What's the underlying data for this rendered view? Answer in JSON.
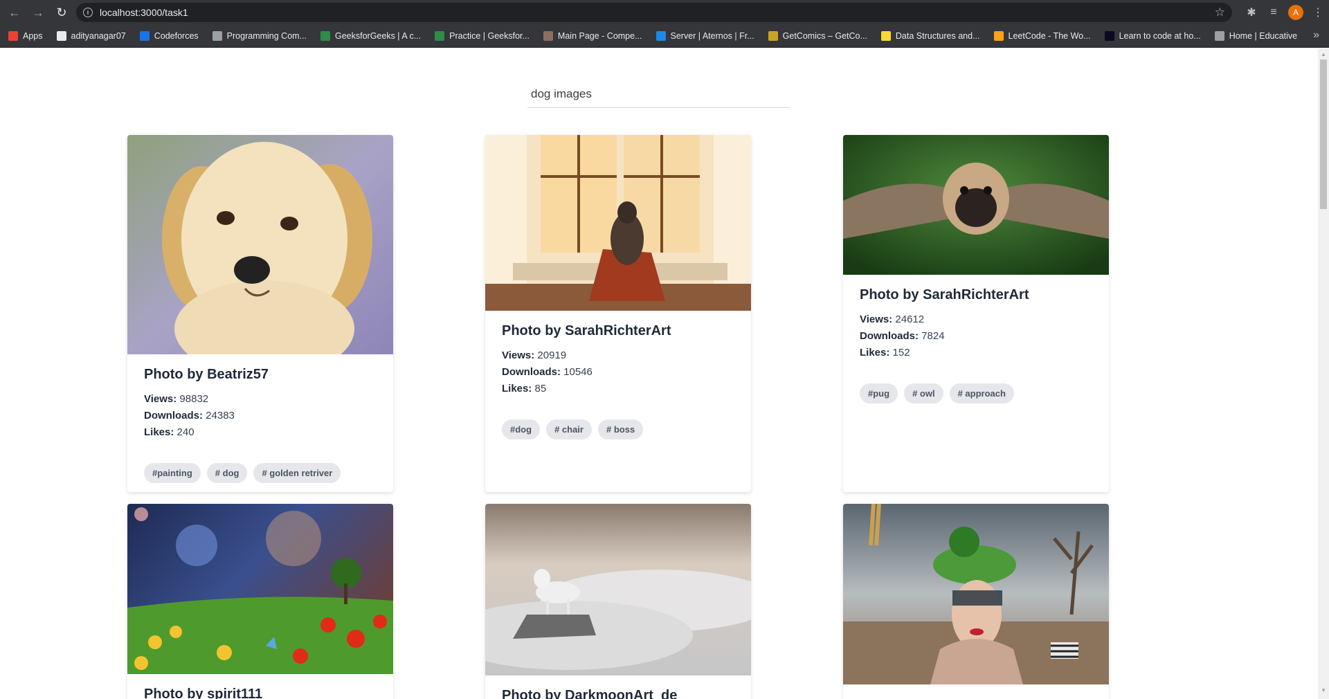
{
  "browser": {
    "url": "localhost:3000/task1",
    "profile_initial": "A",
    "bookmarks": [
      {
        "label": "Apps",
        "color": "#ea4335"
      },
      {
        "label": "adityanagar07",
        "color": "#e8eaed"
      },
      {
        "label": "Codeforces",
        "color": "#1a73e8"
      },
      {
        "label": "Programming Com...",
        "color": "#9aa0a6"
      },
      {
        "label": "GeeksforGeeks | A c...",
        "color": "#2f8d46"
      },
      {
        "label": "Practice | Geeksfor...",
        "color": "#2f8d46"
      },
      {
        "label": "Main Page - Compe...",
        "color": "#8d6e63"
      },
      {
        "label": "Server | Aternos | Fr...",
        "color": "#1e88e5"
      },
      {
        "label": "GetComics – GetCo...",
        "color": "#c9a227"
      },
      {
        "label": "Data Structures and...",
        "color": "#fdd835"
      },
      {
        "label": "LeetCode - The Wo...",
        "color": "#ffa116"
      },
      {
        "label": "Learn to code at ho...",
        "color": "#0a0a23"
      },
      {
        "label": "Home | Educative",
        "color": "#9aa0a6"
      }
    ]
  },
  "search": {
    "value": "dog images"
  },
  "cards": [
    {
      "title": "Photo by Beatriz57",
      "views": "98832",
      "downloads": "24383",
      "likes": "240",
      "tags": [
        "#painting",
        "# dog",
        "# golden retriver"
      ],
      "image": "golden-retriever-puppy-painting"
    },
    {
      "title": "Photo by SarahRichterArt",
      "views": "20919",
      "downloads": "10546",
      "likes": "85",
      "tags": [
        "#dog",
        "# chair",
        "# boss"
      ],
      "image": "dog-on-chair-by-window"
    },
    {
      "title": "Photo by SarahRichterArt",
      "views": "24612",
      "downloads": "7824",
      "likes": "152",
      "tags": [
        "#pug",
        "# owl",
        "# approach"
      ],
      "image": "pug-with-owl-wings"
    },
    {
      "title": "Photo by spirit111",
      "image": "meadow-under-nebula"
    },
    {
      "title": "Photo by DarkmoonArt_de",
      "image": "white-wolf-on-cliff"
    },
    {
      "title": "",
      "image": "woman-with-island-hat"
    }
  ],
  "labels": {
    "views": "Views:",
    "downloads": "Downloads:",
    "likes": "Likes:"
  }
}
